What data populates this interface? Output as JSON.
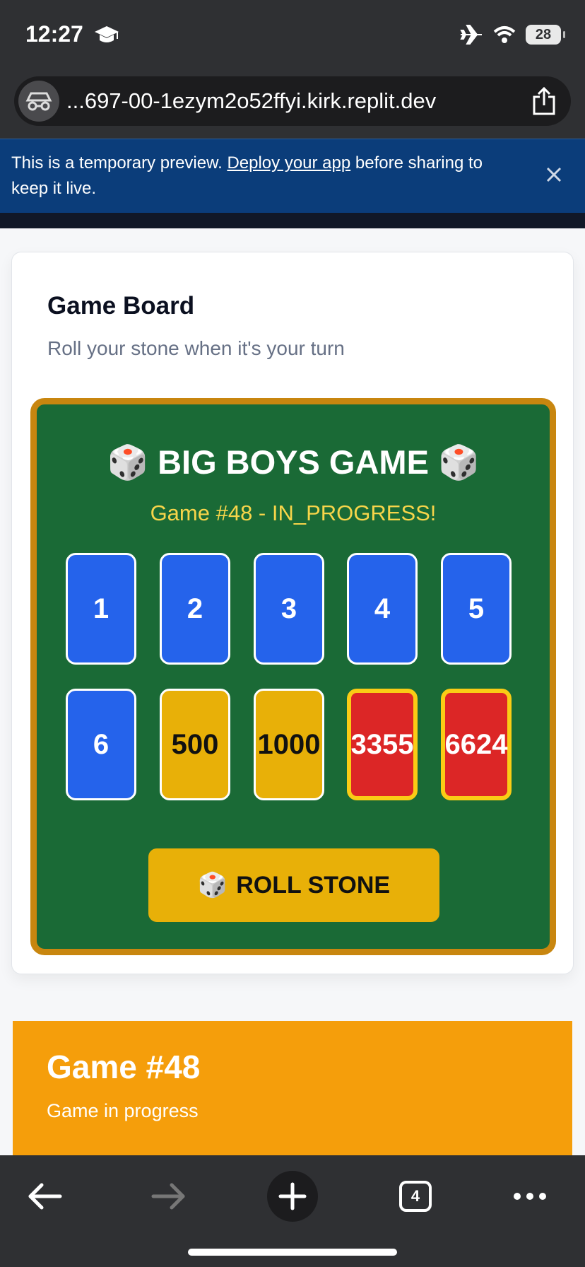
{
  "status_bar": {
    "time": "12:27",
    "battery": "28"
  },
  "browser": {
    "url": "...697-00-1ezym2o52ffyi.kirk.replit.dev",
    "tab_count": "4"
  },
  "banner": {
    "text_before": "This is a temporary preview. ",
    "link": "Deploy your app",
    "text_after": " before sharing to keep it live."
  },
  "card": {
    "title": "Game Board",
    "subtitle": "Roll your stone when it's your turn"
  },
  "board": {
    "die": "🎲",
    "title": "BIG BOYS GAME",
    "status": "Game #48 - IN_PROGRESS!",
    "tiles": [
      {
        "label": "1",
        "style": "blue"
      },
      {
        "label": "2",
        "style": "blue"
      },
      {
        "label": "3",
        "style": "blue"
      },
      {
        "label": "4",
        "style": "blue"
      },
      {
        "label": "5",
        "style": "blue"
      },
      {
        "label": "6",
        "style": "blue"
      },
      {
        "label": "500",
        "style": "gold"
      },
      {
        "label": "1000",
        "style": "gold"
      },
      {
        "label": "3355",
        "style": "red"
      },
      {
        "label": "6624",
        "style": "red"
      }
    ],
    "roll_button": "ROLL STONE"
  },
  "game_panel": {
    "title": "Game #48",
    "subtitle": "Game in progress"
  },
  "colors": {
    "board_green": "#1a6a36",
    "board_border": "#c8860f",
    "tile_blue": "#2563eb",
    "tile_gold": "#e8b008",
    "tile_red": "#dc2626",
    "banner_blue": "#0b3d7a",
    "panel_orange": "#f59e0b"
  },
  "icons": {
    "status": [
      "graduation-cap-icon",
      "airplane-icon",
      "wifi-icon",
      "battery-icon"
    ],
    "url_bar": [
      "incognito-icon",
      "share-icon"
    ],
    "banner": [
      "close-icon"
    ],
    "toolbar": [
      "back-arrow-icon",
      "forward-arrow-icon",
      "plus-icon",
      "tabs-icon",
      "more-icon"
    ]
  }
}
